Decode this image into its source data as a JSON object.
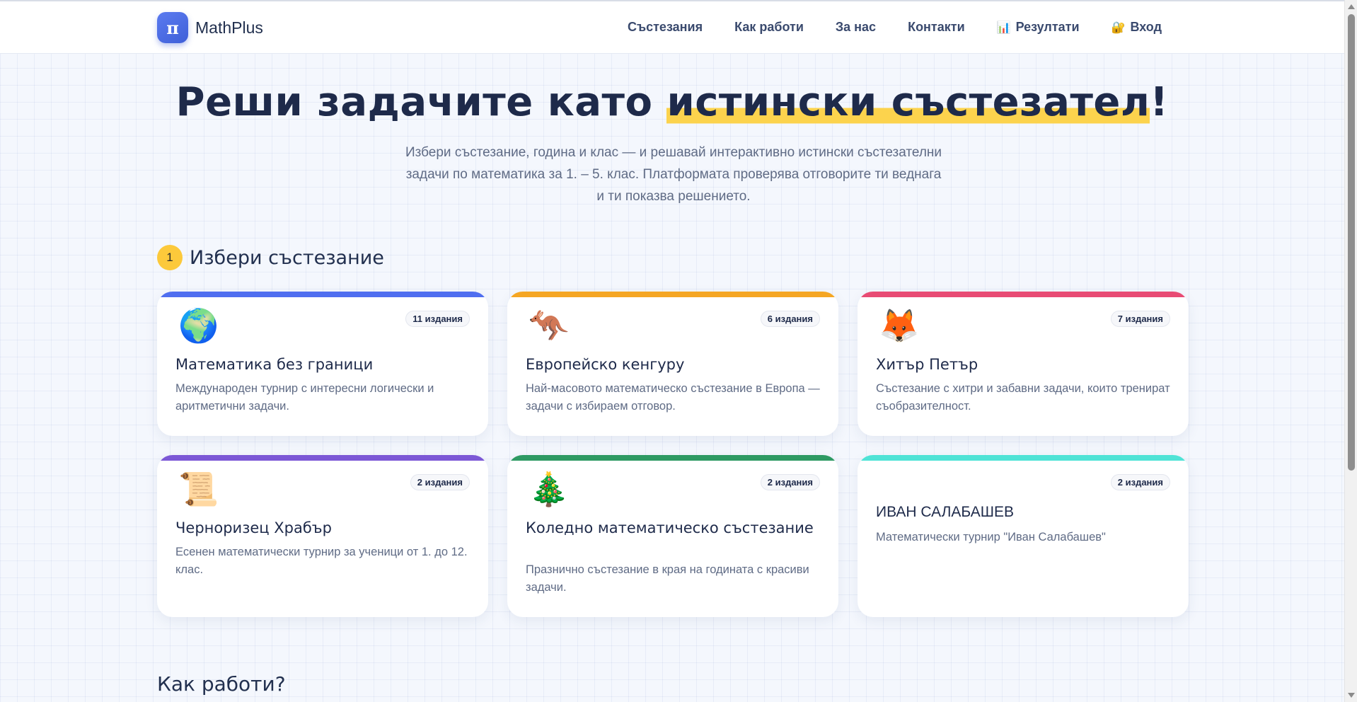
{
  "brand": {
    "logo_symbol": "π",
    "name": "MathPlus"
  },
  "nav": [
    {
      "icon": "",
      "label": "Състезания"
    },
    {
      "icon": "",
      "label": "Как работи"
    },
    {
      "icon": "",
      "label": "За нас"
    },
    {
      "icon": "",
      "label": "Контакти"
    },
    {
      "icon": "📊",
      "label": "Резултати"
    },
    {
      "icon": "🔐",
      "label": "Вход"
    }
  ],
  "hero": {
    "title_before": "Реши задачите като ",
    "title_highlight": "истински състезател",
    "title_after": "!",
    "subtitle": "Избери състезание, година и клас — и решавай интерактивно истински състезателни задачи по математика за 1. – 5. клас. Платформата проверява отговорите ти веднага и ти показва решението."
  },
  "step": {
    "number": "1",
    "title": "Избери състезание"
  },
  "competitions": [
    {
      "icon": "🌍",
      "badge": "11 издания",
      "title": "Математика без граници",
      "description": "Международен турнир с интересни логически и аритметични задачи.",
      "color": "#4f6ef0"
    },
    {
      "icon": "🦘",
      "badge": "6 издания",
      "title": "Европейско кенгуру",
      "description": "Най-масовото математическо състезание в Европа — задачи с избираем отговор.",
      "color": "#f5a623"
    },
    {
      "icon": "🦊",
      "badge": "7 издания",
      "title": "Хитър Петър",
      "description": "Състезание с хитри и забавни задачи, които тренират съобразителност.",
      "color": "#e84b74"
    },
    {
      "icon": "📜",
      "badge": "2 издания",
      "title": "Черноризец Храбър",
      "description": "Есенен математически турнир за ученици от 1. до 12. клас.",
      "color": "#7c58d6"
    },
    {
      "icon": "🎄",
      "badge": "2 издания",
      "title": "Коледно математическо състезание",
      "description": "Празнично състезание в края на годината с красиви задачи.",
      "color": "#2e9a63"
    },
    {
      "icon": "",
      "badge": "2 издания",
      "title": "ИВАН САЛАБАШЕВ",
      "description": "Математически турнир \"Иван Салабашев\"",
      "color": "#4fe3d6"
    }
  ],
  "how_it_works": {
    "title": "Как работи?"
  }
}
